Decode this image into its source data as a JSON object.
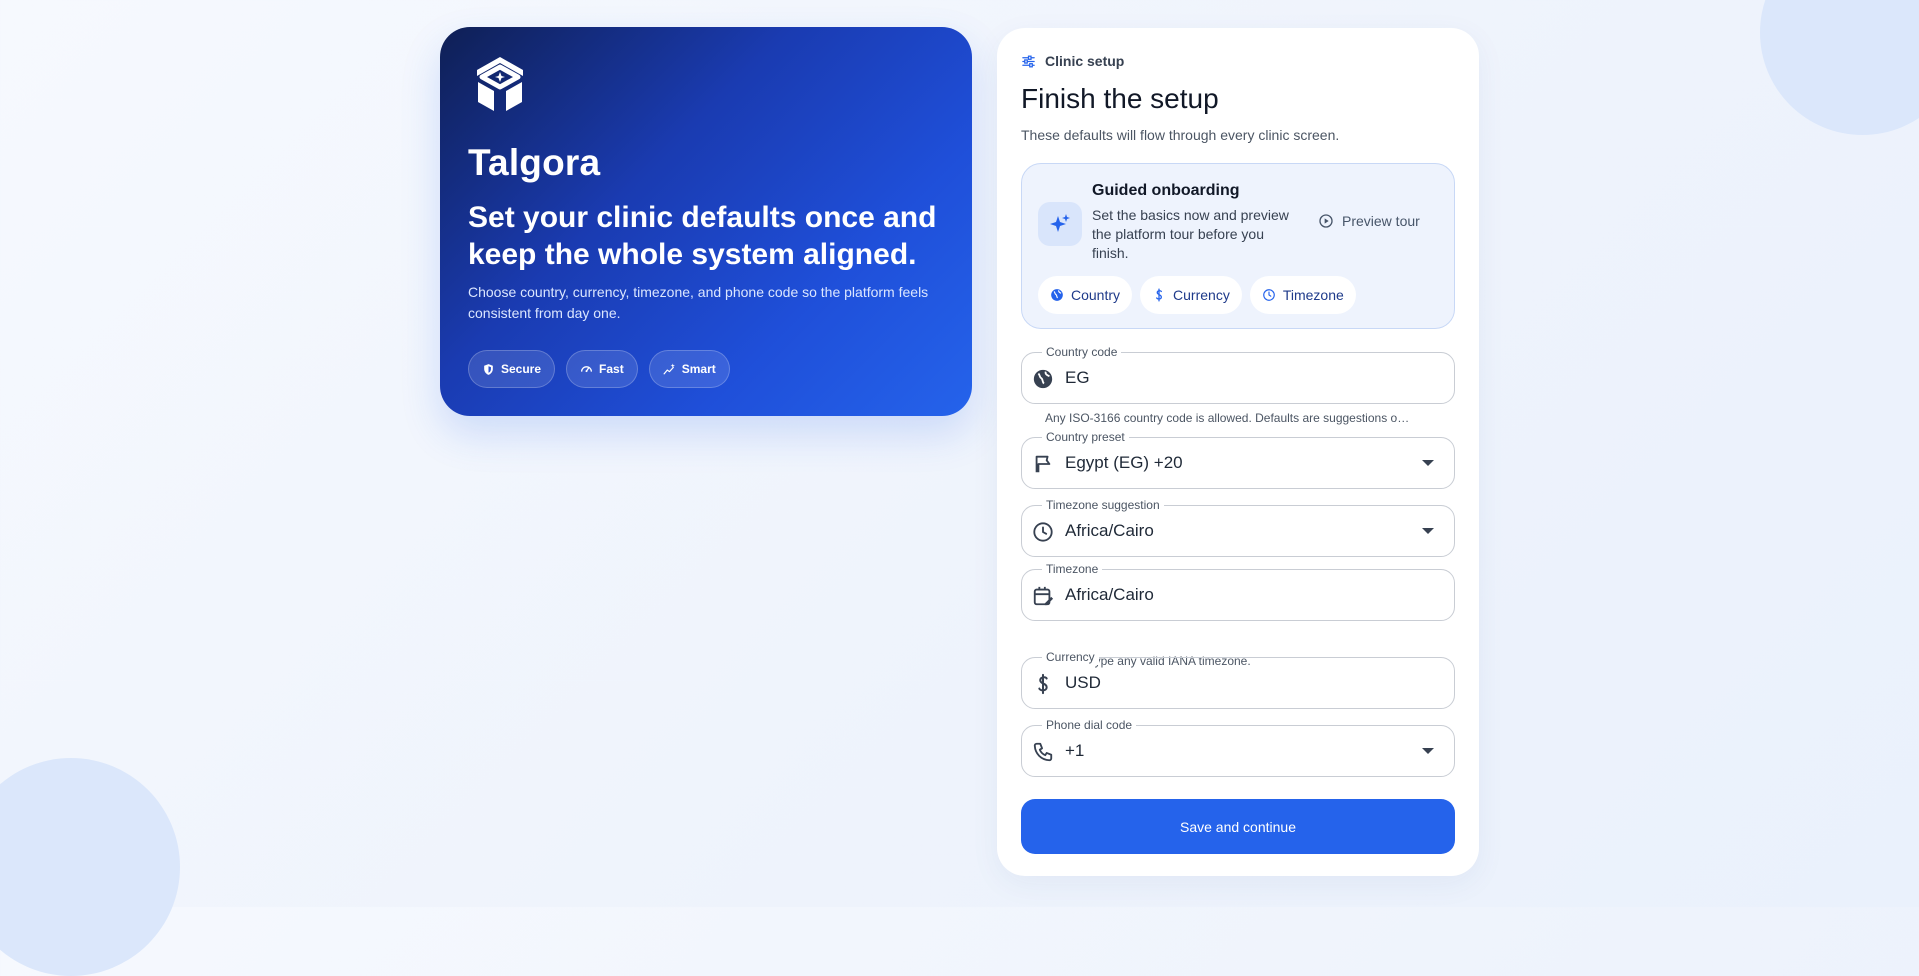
{
  "hero": {
    "brand": "Talgora",
    "headline": "Set your clinic defaults once and keep the whole system aligned.",
    "description": "Choose country, currency, timezone, and phone code so the platform feels consistent from day one.",
    "chips": [
      {
        "label": "Secure",
        "icon": "shield-icon"
      },
      {
        "label": "Fast",
        "icon": "speedometer-icon"
      },
      {
        "label": "Smart",
        "icon": "sparkle-trend-icon"
      }
    ]
  },
  "card": {
    "breadcrumb": "Clinic setup",
    "title": "Finish the setup",
    "subtitle": "These defaults will flow through every clinic screen.",
    "onboarding": {
      "title": "Guided onboarding",
      "description": "Set the basics now and preview the platform tour before you finish.",
      "preview_label": "Preview tour",
      "chips": [
        {
          "label": "Country",
          "icon": "globe-icon"
        },
        {
          "label": "Currency",
          "icon": "dollar-icon"
        },
        {
          "label": "Timezone",
          "icon": "clock-icon"
        }
      ]
    },
    "fields": {
      "country_code": {
        "label": "Country code",
        "value": "EG",
        "hint": "Any ISO-3166 country code is allowed. Defaults are suggestions o…",
        "icon": "globe-icon"
      },
      "country_preset": {
        "label": "Country preset",
        "value": "Egypt (EG) +20",
        "icon": "flag-icon"
      },
      "timezone_suggestion": {
        "label": "Timezone suggestion",
        "value": "Africa/Cairo",
        "icon": "clock-icon"
      },
      "timezone": {
        "label": "Timezone",
        "value": "Africa/Cairo",
        "hint": "You can type any valid IANA timezone.",
        "icon": "calendar-edit-icon"
      },
      "currency": {
        "label": "Currency",
        "value": "USD",
        "icon": "dollar-icon"
      },
      "phone_dial_code": {
        "label": "Phone dial code",
        "value": "+1",
        "icon": "phone-icon"
      }
    },
    "save_label": "Save and continue"
  },
  "colors": {
    "accent": "#2563eb",
    "hero_dark": "#0f1f54",
    "onboarding_bg": "#eef3fd"
  }
}
